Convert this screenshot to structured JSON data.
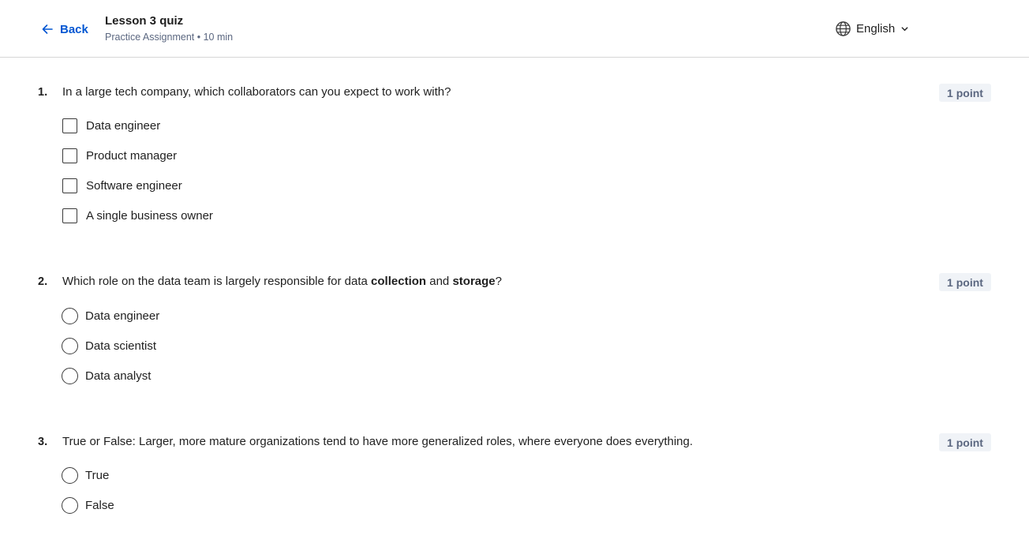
{
  "header": {
    "back_label": "Back",
    "title": "Lesson 3 quiz",
    "subtitle": "Practice Assignment • 10 min",
    "language": "English"
  },
  "questions": [
    {
      "number": "1.",
      "text": "In a large tech company, which collaborators can you expect to work with?",
      "points": "1 point",
      "type": "checkbox",
      "options": [
        "Data engineer",
        "Product manager",
        "Software engineer",
        "A single business owner"
      ]
    },
    {
      "number": "2.",
      "text_before": "Which role on the data team is largely responsible for data ",
      "text_bold1": "collection",
      "text_middle": " and ",
      "text_bold2": "storage",
      "text_after": "?",
      "points": "1 point",
      "type": "radio",
      "options": [
        "Data engineer",
        "Data scientist",
        "Data analyst"
      ]
    },
    {
      "number": "3.",
      "text": "True or False: Larger, more mature organizations tend to have more generalized roles, where everyone does everything.",
      "points": "1 point",
      "type": "radio",
      "options": [
        "True",
        "False"
      ]
    }
  ],
  "colors": {
    "accent": "#0056d2",
    "muted": "#5b6780",
    "badge_bg": "#f0f3f7"
  },
  "icons": {
    "back": "arrow-left-icon",
    "language": "globe-icon",
    "dropdown": "chevron-down-icon"
  }
}
